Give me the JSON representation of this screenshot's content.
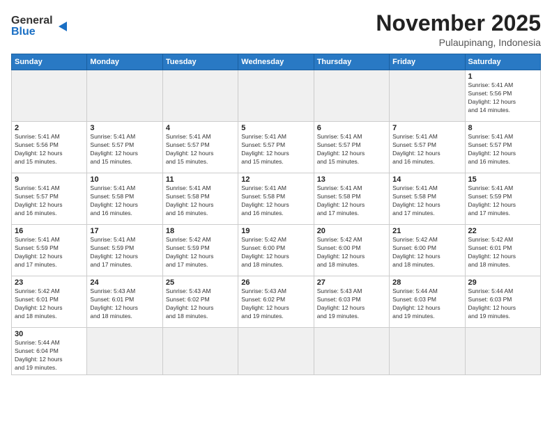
{
  "header": {
    "logo_general": "General",
    "logo_blue": "Blue",
    "month_year": "November 2025",
    "location": "Pulaupinang, Indonesia"
  },
  "weekdays": [
    "Sunday",
    "Monday",
    "Tuesday",
    "Wednesday",
    "Thursday",
    "Friday",
    "Saturday"
  ],
  "days": [
    {
      "date": "",
      "info": ""
    },
    {
      "date": "",
      "info": ""
    },
    {
      "date": "",
      "info": ""
    },
    {
      "date": "",
      "info": ""
    },
    {
      "date": "",
      "info": ""
    },
    {
      "date": "",
      "info": ""
    },
    {
      "date": "1",
      "info": "Sunrise: 5:41 AM\nSunset: 5:56 PM\nDaylight: 12 hours\nand 14 minutes."
    },
    {
      "date": "2",
      "info": "Sunrise: 5:41 AM\nSunset: 5:56 PM\nDaylight: 12 hours\nand 15 minutes."
    },
    {
      "date": "3",
      "info": "Sunrise: 5:41 AM\nSunset: 5:57 PM\nDaylight: 12 hours\nand 15 minutes."
    },
    {
      "date": "4",
      "info": "Sunrise: 5:41 AM\nSunset: 5:57 PM\nDaylight: 12 hours\nand 15 minutes."
    },
    {
      "date": "5",
      "info": "Sunrise: 5:41 AM\nSunset: 5:57 PM\nDaylight: 12 hours\nand 15 minutes."
    },
    {
      "date": "6",
      "info": "Sunrise: 5:41 AM\nSunset: 5:57 PM\nDaylight: 12 hours\nand 15 minutes."
    },
    {
      "date": "7",
      "info": "Sunrise: 5:41 AM\nSunset: 5:57 PM\nDaylight: 12 hours\nand 16 minutes."
    },
    {
      "date": "8",
      "info": "Sunrise: 5:41 AM\nSunset: 5:57 PM\nDaylight: 12 hours\nand 16 minutes."
    },
    {
      "date": "9",
      "info": "Sunrise: 5:41 AM\nSunset: 5:57 PM\nDaylight: 12 hours\nand 16 minutes."
    },
    {
      "date": "10",
      "info": "Sunrise: 5:41 AM\nSunset: 5:58 PM\nDaylight: 12 hours\nand 16 minutes."
    },
    {
      "date": "11",
      "info": "Sunrise: 5:41 AM\nSunset: 5:58 PM\nDaylight: 12 hours\nand 16 minutes."
    },
    {
      "date": "12",
      "info": "Sunrise: 5:41 AM\nSunset: 5:58 PM\nDaylight: 12 hours\nand 16 minutes."
    },
    {
      "date": "13",
      "info": "Sunrise: 5:41 AM\nSunset: 5:58 PM\nDaylight: 12 hours\nand 17 minutes."
    },
    {
      "date": "14",
      "info": "Sunrise: 5:41 AM\nSunset: 5:58 PM\nDaylight: 12 hours\nand 17 minutes."
    },
    {
      "date": "15",
      "info": "Sunrise: 5:41 AM\nSunset: 5:59 PM\nDaylight: 12 hours\nand 17 minutes."
    },
    {
      "date": "16",
      "info": "Sunrise: 5:41 AM\nSunset: 5:59 PM\nDaylight: 12 hours\nand 17 minutes."
    },
    {
      "date": "17",
      "info": "Sunrise: 5:41 AM\nSunset: 5:59 PM\nDaylight: 12 hours\nand 17 minutes."
    },
    {
      "date": "18",
      "info": "Sunrise: 5:42 AM\nSunset: 5:59 PM\nDaylight: 12 hours\nand 17 minutes."
    },
    {
      "date": "19",
      "info": "Sunrise: 5:42 AM\nSunset: 6:00 PM\nDaylight: 12 hours\nand 18 minutes."
    },
    {
      "date": "20",
      "info": "Sunrise: 5:42 AM\nSunset: 6:00 PM\nDaylight: 12 hours\nand 18 minutes."
    },
    {
      "date": "21",
      "info": "Sunrise: 5:42 AM\nSunset: 6:00 PM\nDaylight: 12 hours\nand 18 minutes."
    },
    {
      "date": "22",
      "info": "Sunrise: 5:42 AM\nSunset: 6:01 PM\nDaylight: 12 hours\nand 18 minutes."
    },
    {
      "date": "23",
      "info": "Sunrise: 5:42 AM\nSunset: 6:01 PM\nDaylight: 12 hours\nand 18 minutes."
    },
    {
      "date": "24",
      "info": "Sunrise: 5:43 AM\nSunset: 6:01 PM\nDaylight: 12 hours\nand 18 minutes."
    },
    {
      "date": "25",
      "info": "Sunrise: 5:43 AM\nSunset: 6:02 PM\nDaylight: 12 hours\nand 18 minutes."
    },
    {
      "date": "26",
      "info": "Sunrise: 5:43 AM\nSunset: 6:02 PM\nDaylight: 12 hours\nand 19 minutes."
    },
    {
      "date": "27",
      "info": "Sunrise: 5:43 AM\nSunset: 6:03 PM\nDaylight: 12 hours\nand 19 minutes."
    },
    {
      "date": "28",
      "info": "Sunrise: 5:44 AM\nSunset: 6:03 PM\nDaylight: 12 hours\nand 19 minutes."
    },
    {
      "date": "29",
      "info": "Sunrise: 5:44 AM\nSunset: 6:03 PM\nDaylight: 12 hours\nand 19 minutes."
    },
    {
      "date": "30",
      "info": "Sunrise: 5:44 AM\nSunset: 6:04 PM\nDaylight: 12 hours\nand 19 minutes."
    },
    {
      "date": "",
      "info": ""
    },
    {
      "date": "",
      "info": ""
    },
    {
      "date": "",
      "info": ""
    },
    {
      "date": "",
      "info": ""
    },
    {
      "date": "",
      "info": ""
    },
    {
      "date": "",
      "info": ""
    }
  ]
}
